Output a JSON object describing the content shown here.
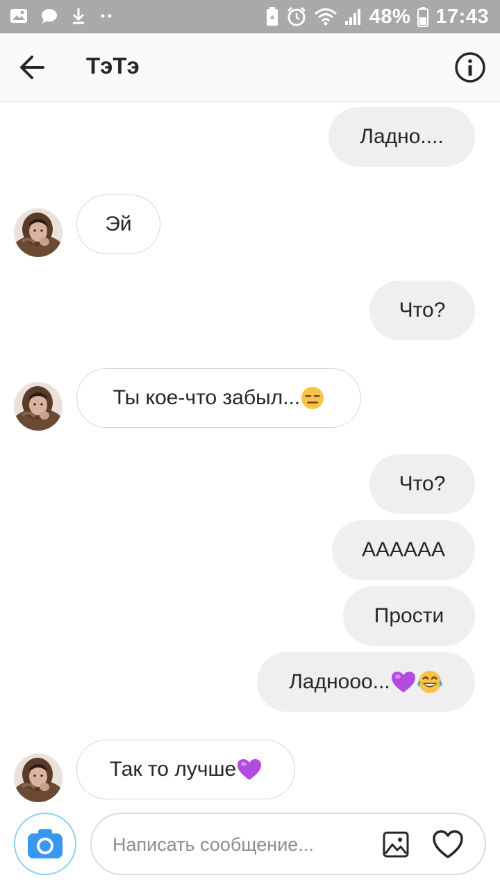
{
  "status_bar": {
    "battery": "48%",
    "time": "17:43",
    "left_icons": [
      "gallery-icon",
      "chat-bubble-icon",
      "download-icon",
      "more-dots-icon"
    ],
    "right_icons": [
      "battery-saver-icon",
      "alarm-icon",
      "wifi-icon",
      "signal-icon",
      "battery-icon"
    ]
  },
  "header": {
    "title": "ТэТэ",
    "back_icon": "arrow-left-icon",
    "info_icon": "info-icon"
  },
  "messages": [
    {
      "direction": "outgoing",
      "text": "Ладно...."
    },
    {
      "direction": "incoming",
      "text": "Эй"
    },
    {
      "direction": "outgoing",
      "text": "Что?"
    },
    {
      "direction": "incoming",
      "text": "Ты кое-что забыл...",
      "emoji": "expressionless-face"
    },
    {
      "direction": "outgoing",
      "text": "Что?"
    },
    {
      "direction": "outgoing",
      "text": "АААААА"
    },
    {
      "direction": "outgoing",
      "text": "Прости"
    },
    {
      "direction": "outgoing",
      "text": "Ладнооо...",
      "emoji": "purple-heart, tears-of-joy"
    },
    {
      "direction": "incoming",
      "text": "Так то лучше",
      "emoji": "purple-heart"
    }
  ],
  "composer": {
    "placeholder": "Написать сообщение...",
    "value": "",
    "camera_icon": "camera-icon",
    "gallery_icon": "gallery-icon",
    "like_icon": "heart-icon"
  },
  "colors": {
    "status_bar": "#a9a9a9",
    "outgoing_bubble": "#efeff0",
    "incoming_border": "#d6d6d6",
    "camera_blue": "#3897f0",
    "purple_heart": "#b44be0"
  }
}
